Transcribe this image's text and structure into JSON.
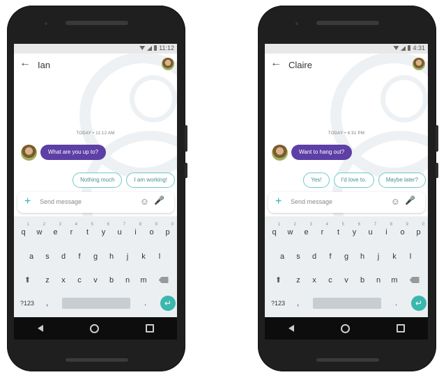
{
  "phones": [
    {
      "status_time": "11:12",
      "contact_name": "Ian",
      "timestamp": "TODAY • 11:12 AM",
      "message": "What are you up to?",
      "suggestions": [
        "Nothing much",
        "I am working!"
      ],
      "compose_placeholder": "Send message"
    },
    {
      "status_time": "4:31",
      "contact_name": "Claire",
      "timestamp": "TODAY • 4:31 PM",
      "message": "Want to hang out?",
      "suggestions": [
        "Yes!",
        "I'd love to.",
        "Maybe later?"
      ],
      "compose_placeholder": "Send message"
    }
  ],
  "keyboard": {
    "row1": [
      "q",
      "w",
      "e",
      "r",
      "t",
      "y",
      "u",
      "i",
      "o",
      "p"
    ],
    "row1_hints": [
      "1",
      "2",
      "3",
      "4",
      "5",
      "6",
      "7",
      "8",
      "9",
      "0"
    ],
    "row2": [
      "a",
      "s",
      "d",
      "f",
      "g",
      "h",
      "j",
      "k",
      "l"
    ],
    "row3": [
      "z",
      "x",
      "c",
      "v",
      "b",
      "n",
      "m"
    ],
    "symbols_key": "?123",
    "comma": ",",
    "period": "."
  },
  "icons": {
    "back": "arrow-left-icon",
    "plus": "plus-icon",
    "emoji": "emoji-icon",
    "mic": "microphone-icon",
    "shift": "shift-icon",
    "delete": "backspace-icon",
    "enter": "enter-icon"
  },
  "colors": {
    "bubble": "#5d3fa6",
    "chip_border": "#6fc9c9",
    "accent": "#3bb8ad",
    "keyboard_bg": "#eceff1"
  }
}
